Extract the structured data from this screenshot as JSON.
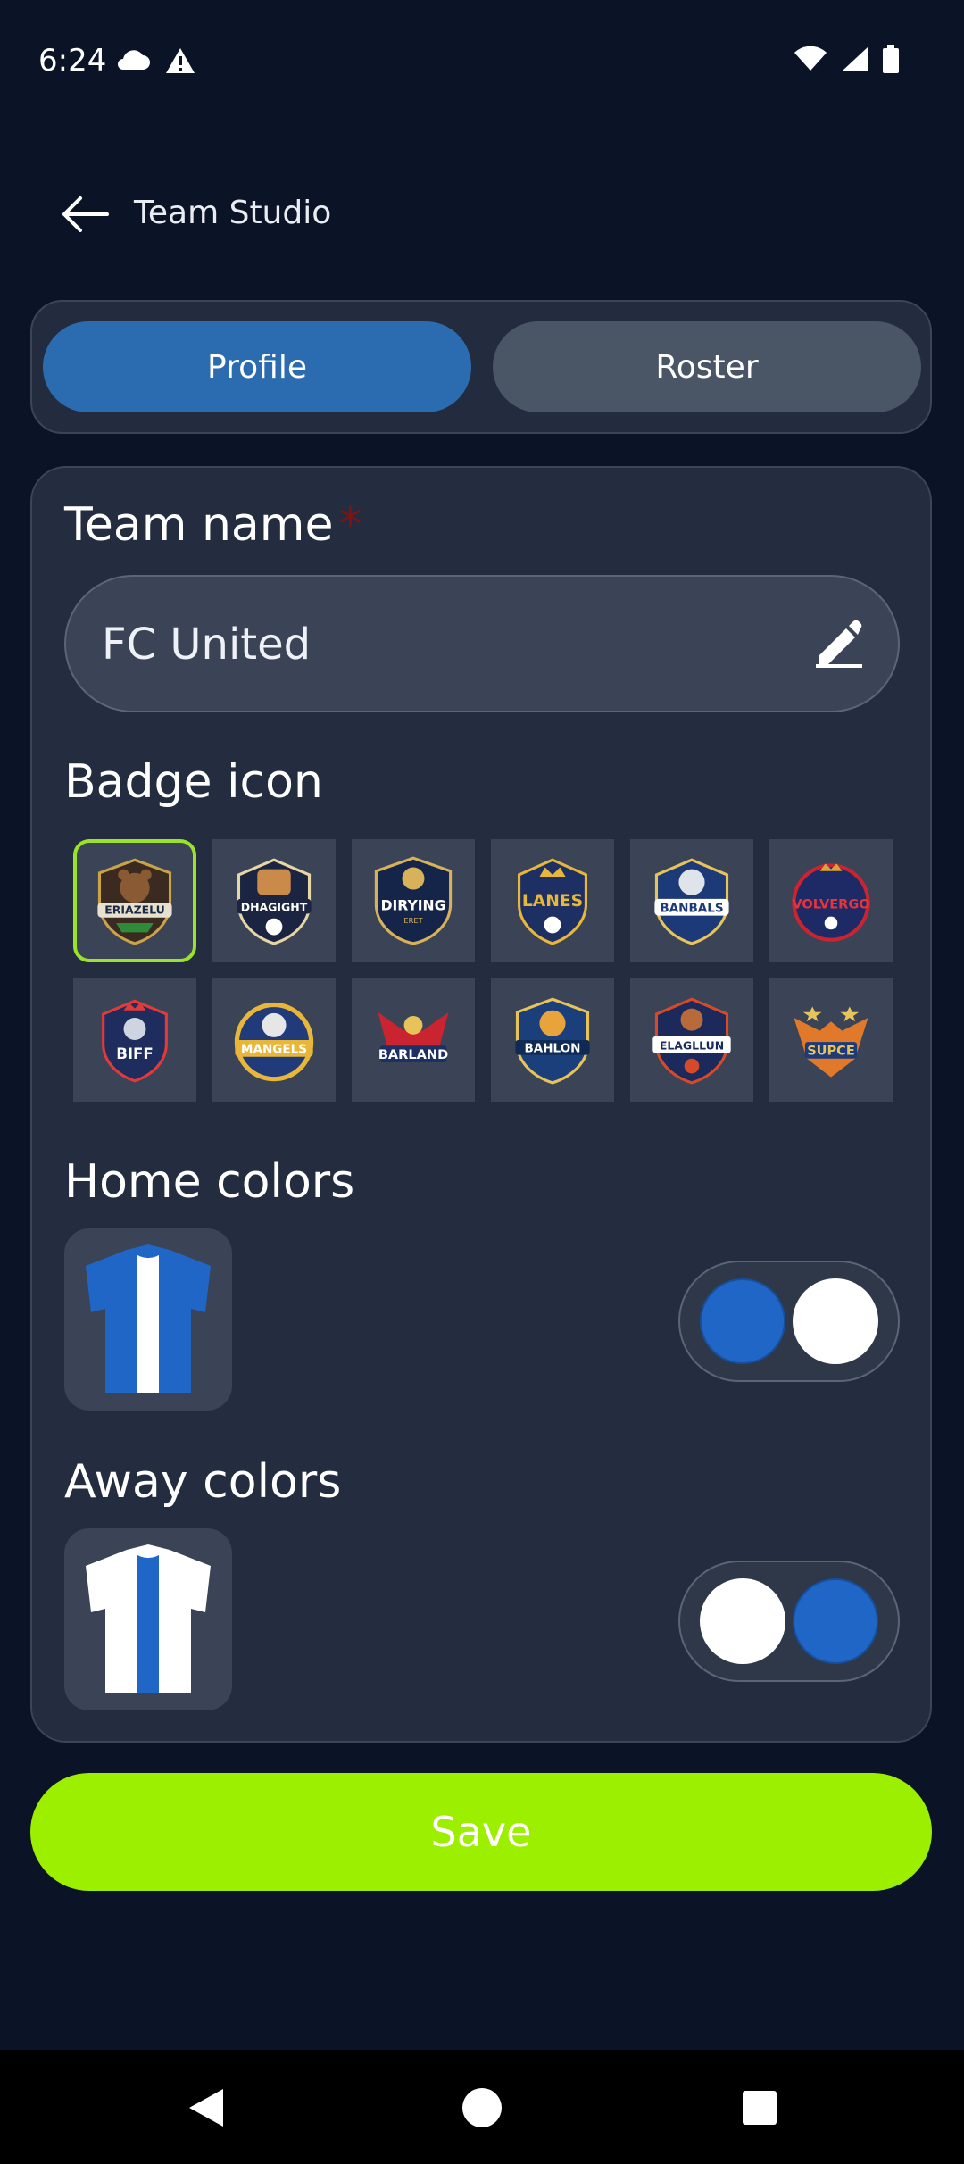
{
  "status_bar": {
    "time": "6:24"
  },
  "app_bar": {
    "title": "Team Studio"
  },
  "tabs": [
    {
      "label": "Profile",
      "selected": true
    },
    {
      "label": "Roster",
      "selected": false
    }
  ],
  "form": {
    "team_name_label": "Team name",
    "required_marker": "*",
    "team_name_value": "FC United",
    "badge_label": "Badge icon",
    "badges": [
      {
        "text": "ERIAZELU",
        "selected": true
      },
      {
        "text": "DHAGIGHT",
        "selected": false
      },
      {
        "text": "DIRYING",
        "selected": false
      },
      {
        "text": "LANES",
        "selected": false
      },
      {
        "text": "BANBALS",
        "selected": false
      },
      {
        "text": "VOLVERGO",
        "selected": false
      },
      {
        "text": "BIFF",
        "selected": false
      },
      {
        "text": "MANGELS",
        "selected": false
      },
      {
        "text": "BARLAND",
        "selected": false
      },
      {
        "text": "BAHLON",
        "selected": false
      },
      {
        "text": "ELAGLLUN",
        "selected": false
      },
      {
        "text": "SUPCE",
        "selected": false
      }
    ],
    "home_colors_label": "Home colors",
    "home_colors": [
      "#1f66c7",
      "#ffffff"
    ],
    "away_colors_label": "Away colors",
    "away_colors": [
      "#ffffff",
      "#1f66c7"
    ]
  },
  "save_label": "Save",
  "colors": {
    "background": "#0b1426",
    "card": "#232d3f",
    "tab_selected": "#2b6cb0",
    "accent": "#9def00",
    "selection_border": "#9be22a"
  },
  "icons": [
    "cloud-icon",
    "warning-icon",
    "wifi-icon",
    "signal-icon",
    "battery-icon",
    "back-arrow-icon",
    "pencil-icon",
    "back-nav-icon",
    "home-nav-icon",
    "recents-nav-icon"
  ]
}
